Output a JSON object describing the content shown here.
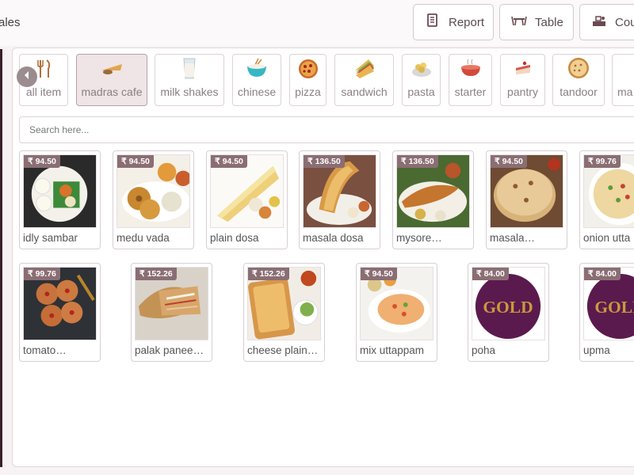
{
  "header": {
    "title_fragment": "ales",
    "buttons": [
      {
        "label": "Report",
        "icon": "report-icon"
      },
      {
        "label": "Table",
        "icon": "table-icon"
      },
      {
        "label": "Cou",
        "icon": "counter-icon"
      }
    ]
  },
  "categories": [
    {
      "label": "all item",
      "icon": "cutlery-icon",
      "active": false
    },
    {
      "label": "madras cafe",
      "icon": "dosa-icon",
      "active": true
    },
    {
      "label": "milk shakes",
      "icon": "glass-icon",
      "active": false
    },
    {
      "label": "chinese",
      "icon": "noodle-bowl-icon",
      "active": false
    },
    {
      "label": "pizza",
      "icon": "pizza-icon",
      "active": false
    },
    {
      "label": "sandwich",
      "icon": "sandwich-icon",
      "active": false
    },
    {
      "label": "pasta",
      "icon": "pasta-icon",
      "active": false
    },
    {
      "label": "starter",
      "icon": "soup-icon",
      "active": false
    },
    {
      "label": "pantry",
      "icon": "cake-icon",
      "active": false
    },
    {
      "label": "tandoor",
      "icon": "naan-icon",
      "active": false
    },
    {
      "label": "ma",
      "icon": "",
      "active": false
    }
  ],
  "search": {
    "placeholder": "Search here...",
    "value": ""
  },
  "products": [
    {
      "name": "idly sambar",
      "price": "₹ 94.50"
    },
    {
      "name": "medu vada",
      "price": "₹ 94.50"
    },
    {
      "name": "plain dosa",
      "price": "₹ 94.50"
    },
    {
      "name": "masala dosa",
      "price": "₹ 136.50"
    },
    {
      "name": "mysore…",
      "price": "₹ 136.50"
    },
    {
      "name": "masala…",
      "price": "₹ 94.50"
    },
    {
      "name": "onion utta",
      "price": "₹ 99.76"
    },
    {
      "name": "tomato…",
      "price": "₹ 99.76"
    },
    {
      "name": "palak panee…",
      "price": "₹ 152.26"
    },
    {
      "name": "cheese plain…",
      "price": "₹ 152.26"
    },
    {
      "name": "mix uttappam",
      "price": "₹ 94.50"
    },
    {
      "name": "poha",
      "price": "₹ 84.00",
      "image_text": "GOLD"
    },
    {
      "name": "upma",
      "price": "₹ 84.00",
      "image_text": "GOLD"
    }
  ],
  "colors": {
    "accent": "#8a6e74",
    "active_category_bg": "#efe4e6",
    "gold_logo_bg": "#5b1a4e",
    "gold_logo_text": "#c99a3c"
  }
}
